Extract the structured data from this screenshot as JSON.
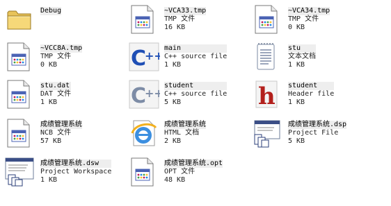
{
  "files": [
    {
      "name": "Debug",
      "type": "",
      "size": "",
      "icon": "folder-icon"
    },
    {
      "name": "~VCA33.tmp",
      "type": "TMP 文件",
      "size": "16 KB",
      "icon": "generic-file-icon"
    },
    {
      "name": "~VCA34.tmp",
      "type": "TMP 文件",
      "size": "0 KB",
      "icon": "generic-file-icon"
    },
    {
      "name": "~VCC8A.tmp",
      "type": "TMP 文件",
      "size": "0 KB",
      "icon": "generic-file-icon"
    },
    {
      "name": "main",
      "type": "C++ source file",
      "size": "1 KB",
      "icon": "cpp-source-icon"
    },
    {
      "name": "stu",
      "type": "文本文档",
      "size": "1 KB",
      "icon": "text-document-icon"
    },
    {
      "name": "stu.dat",
      "type": "DAT 文件",
      "size": "1 KB",
      "icon": "generic-file-icon"
    },
    {
      "name": "student",
      "type": "C++ source file",
      "size": "5 KB",
      "icon": "cpp-source-icon"
    },
    {
      "name": "student",
      "type": "Header file",
      "size": "1 KB",
      "icon": "header-file-icon"
    },
    {
      "name": "成绩管理系统",
      "type": "NCB 文件",
      "size": "57 KB",
      "icon": "generic-file-icon"
    },
    {
      "name": "成绩管理系统",
      "type": "HTML 文档",
      "size": "2 KB",
      "icon": "html-document-icon"
    },
    {
      "name": "成绩管理系统.dsp",
      "type": "Project File",
      "size": "5 KB",
      "icon": "project-file-icon"
    },
    {
      "name": "成绩管理系统.dsw",
      "type": "Project Workspace",
      "size": "1 KB",
      "icon": "workspace-file-icon"
    },
    {
      "name": "成绩管理系统.opt",
      "type": "OPT 文件",
      "size": "48 KB",
      "icon": "generic-file-icon"
    }
  ]
}
